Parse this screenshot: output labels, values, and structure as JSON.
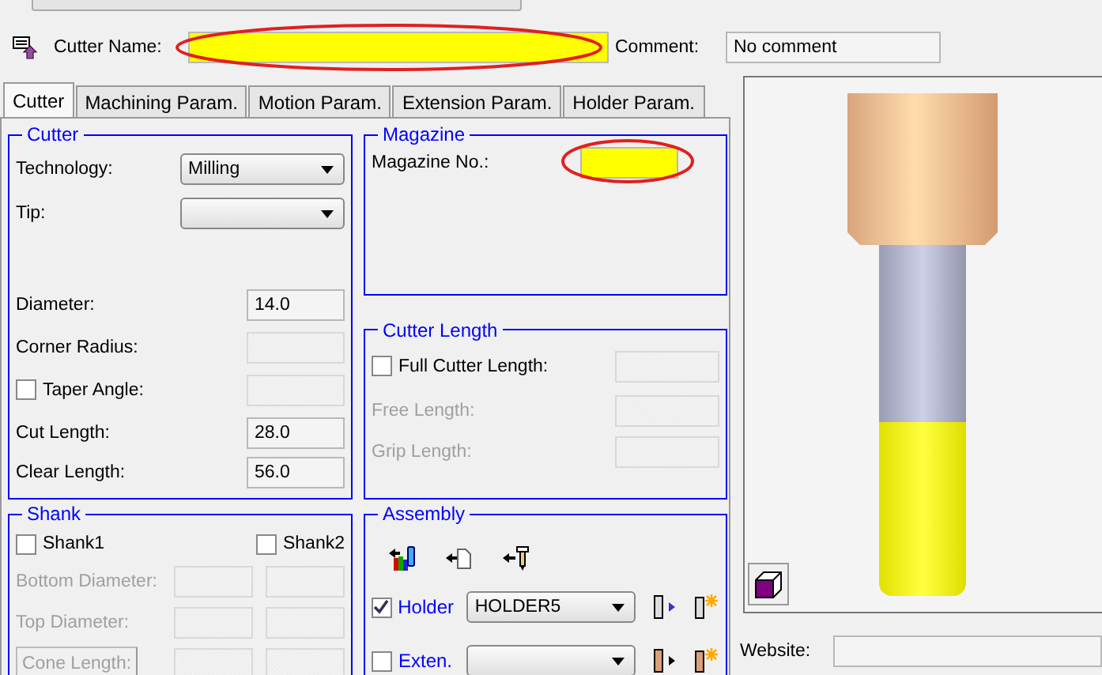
{
  "header": {
    "cutter_name": {
      "label": "Cutter Name:",
      "highlighted": true
    },
    "comment": {
      "label": "Comment:",
      "value": "No comment"
    }
  },
  "tabs": [
    {
      "label": "Cutter",
      "selected": true
    },
    {
      "label": "Machining Param.",
      "selected": false
    },
    {
      "label": "Motion Param.",
      "selected": false
    },
    {
      "label": "Extension Param.",
      "selected": false
    },
    {
      "label": "Holder Param.",
      "selected": false
    }
  ],
  "cutter": {
    "title": "Cutter",
    "technology": {
      "label": "Technology:",
      "value": "Milling"
    },
    "tip": {
      "label": "Tip:"
    },
    "rows": [
      {
        "kind": "field",
        "label": "Diameter:",
        "value": "14.0",
        "disabled": false
      },
      {
        "kind": "field",
        "label": "Corner Radius:",
        "disabled": true
      },
      {
        "kind": "check",
        "label": "Taper Angle:",
        "checked": false,
        "field_disabled": true
      },
      {
        "kind": "field",
        "label": "Cut Length:",
        "value": "28.0",
        "disabled": false
      },
      {
        "kind": "field",
        "label": "Clear Length:",
        "value": "56.0",
        "disabled": false
      }
    ]
  },
  "magazine": {
    "title": "Magazine",
    "label": "Magazine No.:",
    "highlighted": true
  },
  "cutter_length": {
    "title": "Cutter Length",
    "rows": [
      {
        "kind": "check",
        "label": "Full Cutter Length:",
        "checked": false,
        "field_disabled": true
      },
      {
        "kind": "field",
        "label": "Free Length:",
        "disabled": true
      },
      {
        "kind": "field",
        "label": "Grip Length:",
        "disabled": true
      }
    ]
  },
  "shank": {
    "title": "Shank",
    "checks": [
      {
        "label": "Shank1",
        "checked": false
      },
      {
        "label": "Shank2",
        "checked": false
      }
    ],
    "rows": [
      {
        "kind": "label",
        "label": "Bottom Diameter:",
        "disabled": true
      },
      {
        "kind": "label",
        "label": "Top Diameter:",
        "disabled": true
      },
      {
        "kind": "button",
        "label": "Cone Length:",
        "disabled": true
      }
    ]
  },
  "assembly": {
    "title": "Assembly",
    "rows": [
      {
        "kind": "holder",
        "label": "Holder",
        "checked": true,
        "value": "HOLDER5"
      },
      {
        "kind": "extension",
        "label": "Exten.",
        "checked": false
      }
    ]
  },
  "website": {
    "label": "Website:"
  }
}
